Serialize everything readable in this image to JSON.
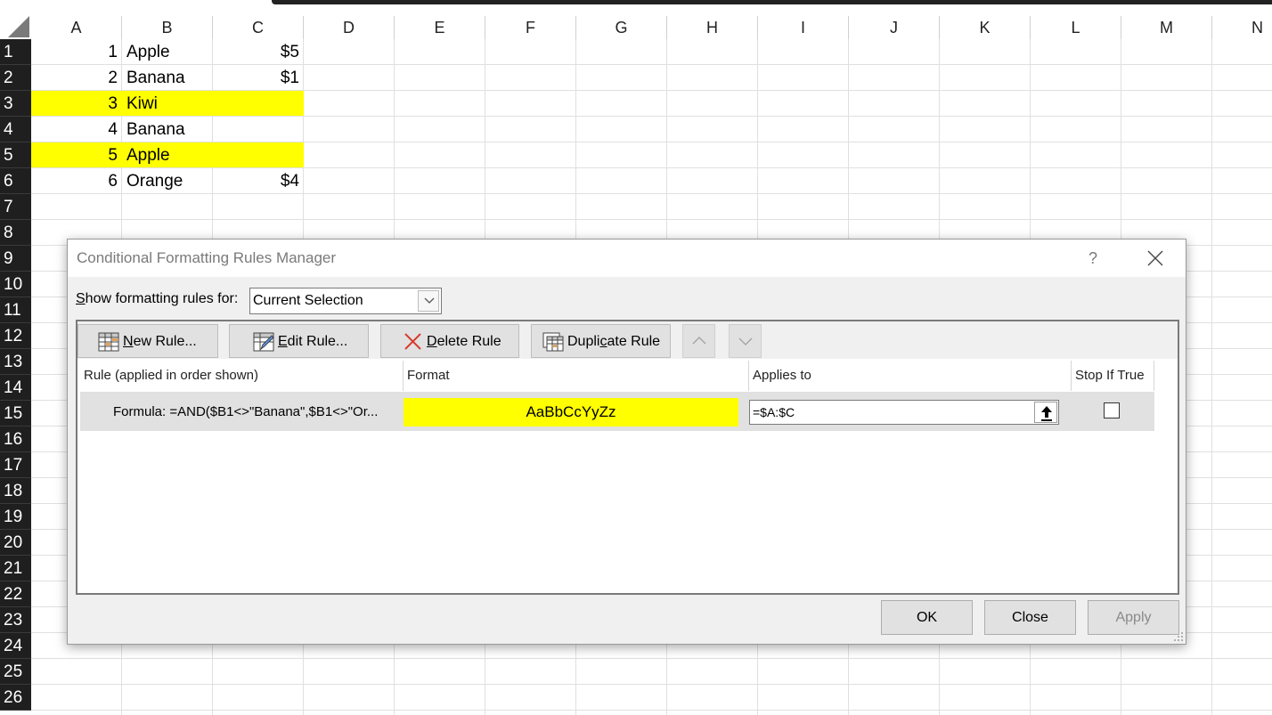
{
  "sheet": {
    "columns": [
      "A",
      "B",
      "C",
      "D",
      "E",
      "F",
      "G",
      "H",
      "I",
      "J",
      "K",
      "L",
      "M",
      "N"
    ],
    "rows": [
      "1",
      "2",
      "3",
      "4",
      "5",
      "6",
      "7",
      "8",
      "9",
      "10",
      "11",
      "12",
      "13",
      "14",
      "15",
      "16",
      "17",
      "18",
      "19",
      "20",
      "21",
      "22",
      "23",
      "24",
      "25",
      "26"
    ],
    "data": [
      {
        "a": "1",
        "b": "Apple",
        "c": "$5",
        "highlight": false
      },
      {
        "a": "2",
        "b": "Banana",
        "c": "$1",
        "highlight": false
      },
      {
        "a": "3",
        "b": "Kiwi",
        "c": "",
        "highlight": true
      },
      {
        "a": "4",
        "b": "Banana",
        "c": "",
        "highlight": false
      },
      {
        "a": "5",
        "b": "Apple",
        "c": "",
        "highlight": true
      },
      {
        "a": "6",
        "b": "Orange",
        "c": "$4",
        "highlight": false
      }
    ],
    "highlight_color": "#ffff00"
  },
  "dialog": {
    "title": "Conditional Formatting Rules Manager",
    "help_label": "?",
    "show_rules_label_pre": "",
    "show_rules_label_mnemonic": "S",
    "show_rules_label_post": "how formatting rules for:",
    "scope_value": "Current Selection",
    "toolbar": {
      "new_rule": {
        "mnemonic": "N",
        "rest": "ew Rule...",
        "pre": ""
      },
      "edit_rule": {
        "mnemonic": "E",
        "rest": "dit Rule...",
        "pre": ""
      },
      "delete_rule": {
        "mnemonic": "D",
        "rest": "elete Rule",
        "pre": ""
      },
      "duplicate_rule": {
        "pre": "Dupli",
        "mnemonic": "c",
        "rest": "ate Rule"
      }
    },
    "table": {
      "headers": {
        "rule": "Rule (applied in order shown)",
        "format": "Format",
        "applies_to": "Applies to",
        "stop_if_true": "Stop If True"
      },
      "rules": [
        {
          "description": "Formula: =AND($B1<>\"Banana\",$B1<>\"Or...",
          "format_preview": "AaBbCcYyZz",
          "applies_to": "=$A:$C",
          "stop_if_true": false
        }
      ]
    },
    "buttons": {
      "ok": "OK",
      "close": "Close",
      "apply": "Apply"
    }
  }
}
